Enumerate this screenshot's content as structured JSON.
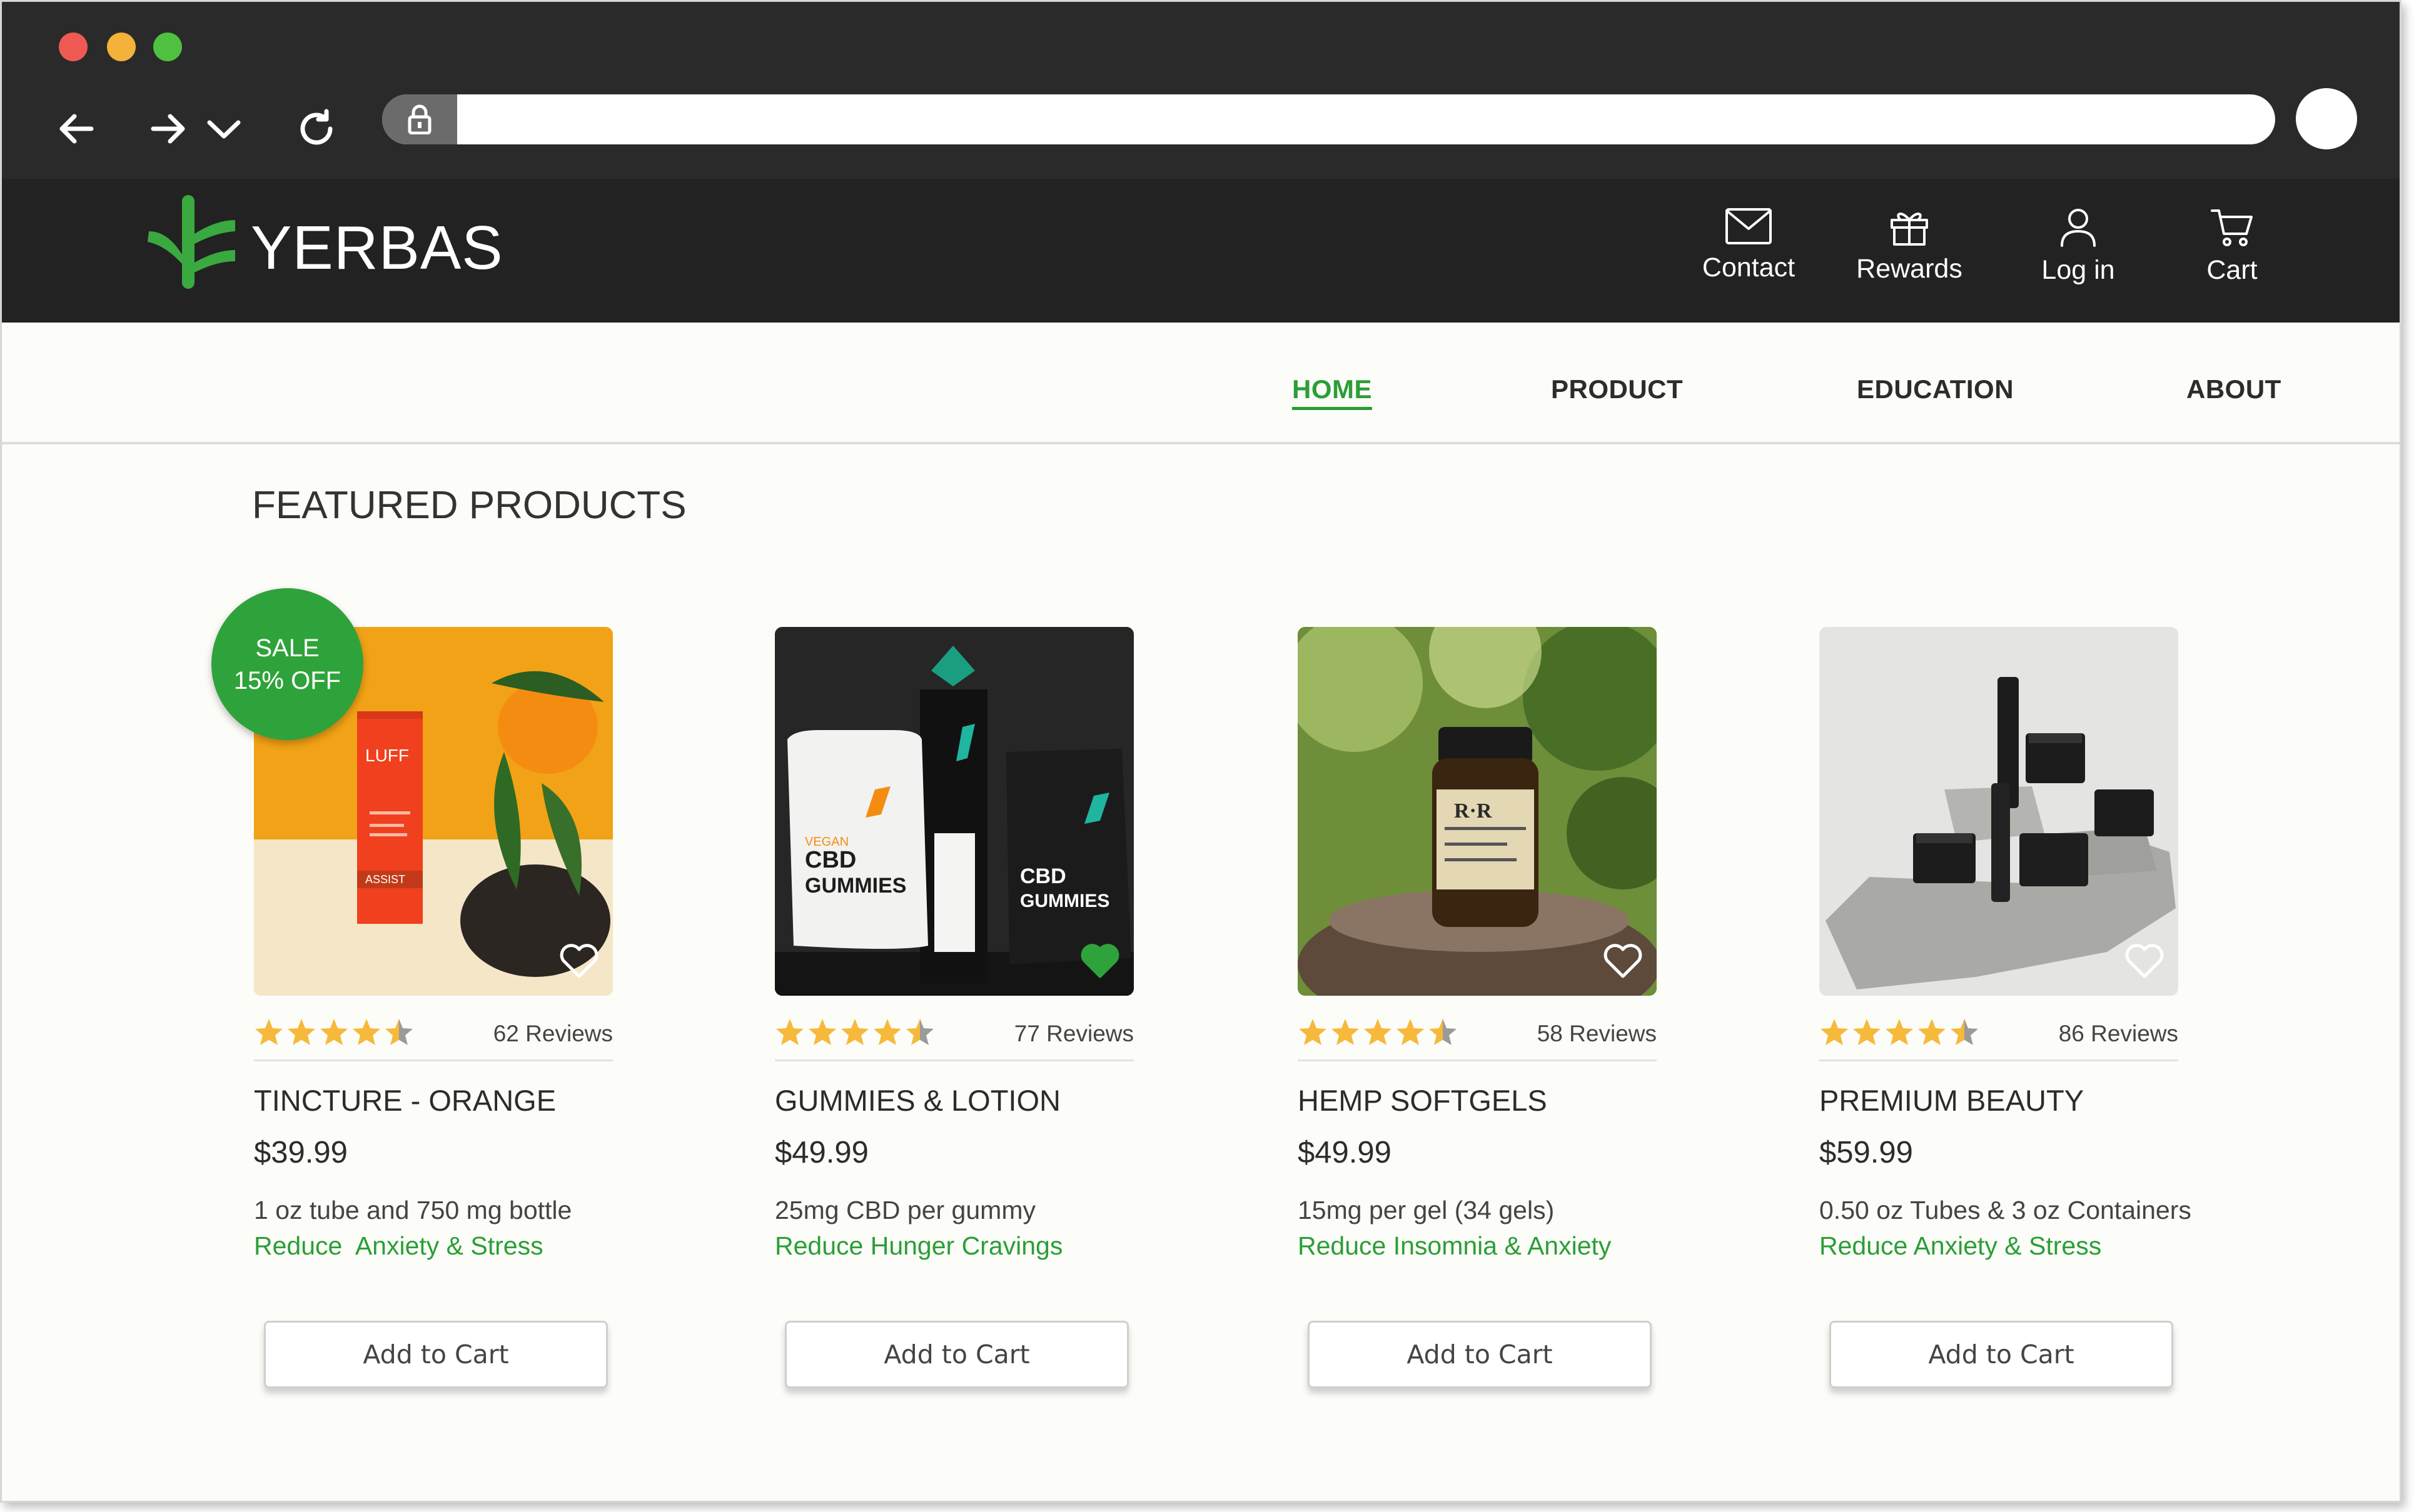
{
  "browser": {
    "url": ""
  },
  "brand": {
    "name": "YERBAS",
    "accent": "#2b9e37"
  },
  "header_links": [
    {
      "label": "Contact",
      "icon": "envelope-icon"
    },
    {
      "label": "Rewards",
      "icon": "gift-icon"
    },
    {
      "label": "Log in",
      "icon": "user-icon"
    },
    {
      "label": "Cart",
      "icon": "cart-icon"
    }
  ],
  "nav": [
    {
      "label": "HOME",
      "active": true
    },
    {
      "label": "PRODUCT",
      "active": false
    },
    {
      "label": "EDUCATION",
      "active": false
    },
    {
      "label": "ABOUT",
      "active": false
    }
  ],
  "featured": {
    "title": "FEATURED PRODUCTS",
    "sale_badge": {
      "line1": "SALE",
      "line2": "15% OFF"
    }
  },
  "products": [
    {
      "name": "TINCTURE - ORANGE",
      "price": "$39.99",
      "rating": 4.5,
      "reviews": "62 Reviews",
      "desc": "1 oz tube and 750 mg bottle",
      "benefit": "Reduce  Anxiety & Stress",
      "favorited": false,
      "button": "Add to Cart",
      "photo": "orange tincture bottle"
    },
    {
      "name": "GUMMIES & LOTION",
      "price": "$49.99",
      "rating": 4.5,
      "reviews": "77 Reviews",
      "desc": "25mg CBD per gummy",
      "benefit": "Reduce Hunger Cravings",
      "favorited": true,
      "button": "Add to Cart",
      "photo": "gummy pouches"
    },
    {
      "name": "HEMP SOFTGELS",
      "price": "$49.99",
      "rating": 4.5,
      "reviews": "58 Reviews",
      "desc": "15mg per gel (34 gels)",
      "benefit": "Reduce Insomnia & Anxiety",
      "favorited": false,
      "button": "Add to Cart",
      "photo": "softgel jar"
    },
    {
      "name": "PREMIUM BEAUTY",
      "price": "$59.99",
      "rating": 4.5,
      "reviews": "86 Reviews",
      "desc": "0.50 oz Tubes & 3 oz Containers",
      "benefit": "Reduce Anxiety & Stress",
      "favorited": false,
      "button": "Add to Cart",
      "photo": "beauty containers"
    }
  ]
}
